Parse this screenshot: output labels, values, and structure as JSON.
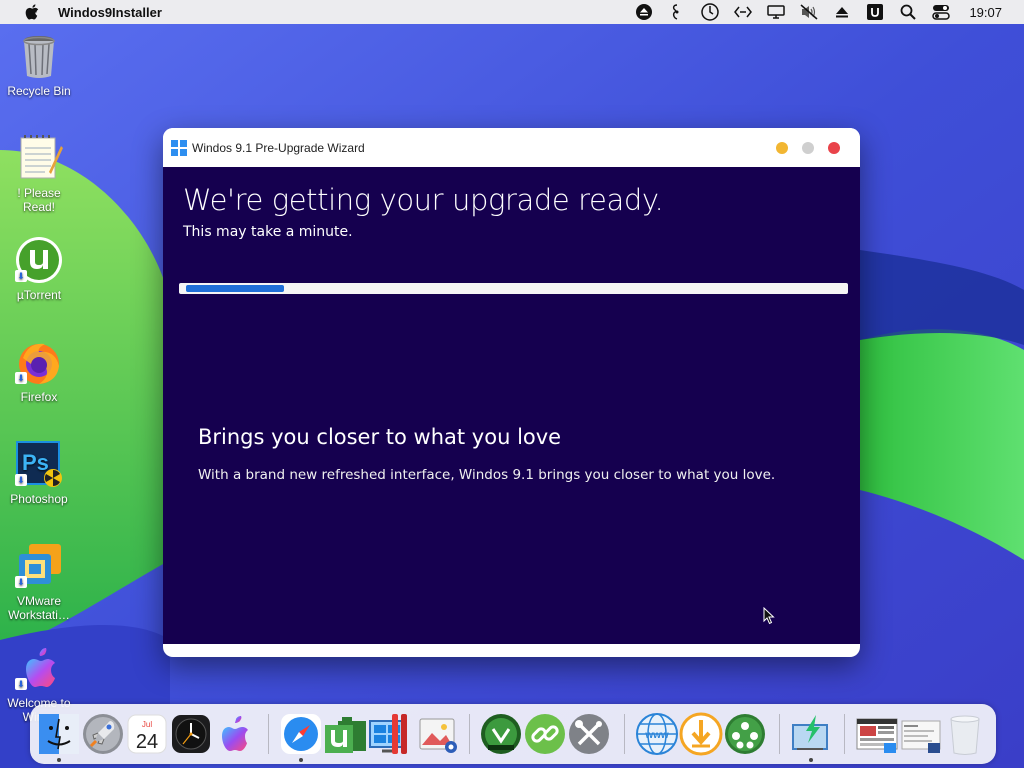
{
  "menubar": {
    "app_name": "Windos9Installer",
    "clock": "19:07",
    "tray_icons": [
      "eject-icon",
      "headphones-icon",
      "activity-icon",
      "network-code-icon",
      "display-icon",
      "mute-icon",
      "upload-icon",
      "u-icon",
      "search-icon",
      "control-center-icon"
    ]
  },
  "desktop": {
    "icons": [
      {
        "label": "Recycle Bin",
        "icon": "trash-icon"
      },
      {
        "label": "! Please Read!",
        "icon": "notepad-icon"
      },
      {
        "label": "µTorrent",
        "icon": "utorrent-icon"
      },
      {
        "label": "Firefox",
        "icon": "firefox-icon"
      },
      {
        "label": "Photoshop",
        "icon": "photoshop-icon"
      },
      {
        "label": "VMware Workstati…",
        "icon": "vmware-icon"
      },
      {
        "label": "Welcome to Win…",
        "icon": "apple-welcome-icon"
      }
    ]
  },
  "window": {
    "title": "Windos 9.1 Pre-Upgrade Wizard",
    "heading": "We're getting your upgrade ready.",
    "subheading": "This may take a minute.",
    "progress": 0.15,
    "feature_title": "Brings you closer to what you love",
    "feature_desc": "With a brand new refreshed interface, Windos 9.1 brings you closer to what you love.",
    "colors": {
      "content_bg": "#15004f",
      "progress_fill": "#1f6fd8",
      "minimize": "#f2b632",
      "zoom": "#cfcfcf",
      "close": "#e9434a"
    }
  },
  "dock": {
    "calendar_month": "Jul",
    "calendar_day": "24",
    "items": [
      "finder-icon",
      "launchpad-icon",
      "calendar-icon",
      "clock-icon",
      "apple-icon",
      "safari-icon",
      "utorrent-icon",
      "windows-installer-icon",
      "parallels-icon",
      "photo-icon",
      "wine-icon",
      "link-icon",
      "tools-icon",
      "web-icon",
      "download-icon",
      "network-icon",
      "installer-icon",
      "window-thumbnail",
      "window-thumbnail",
      "trash-icon"
    ]
  }
}
